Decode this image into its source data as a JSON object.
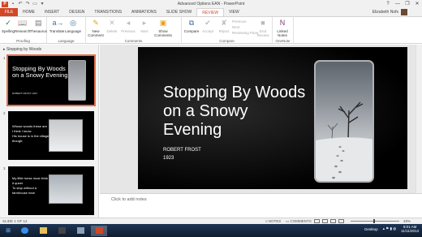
{
  "window": {
    "title": "Advanced Options EAN - PowerPoint",
    "controls": [
      "?",
      "—",
      "❐",
      "✕"
    ]
  },
  "tabs": [
    "FILE",
    "HOME",
    "INSERT",
    "DESIGN",
    "TRANSITIONS",
    "ANIMATIONS",
    "SLIDE SHOW",
    "REVIEW",
    "VIEW"
  ],
  "active_tab": "REVIEW",
  "user": {
    "name": "Elizabeth Nofs"
  },
  "ribbon": {
    "proofing": {
      "label": "Proofing",
      "spelling": "Spelling",
      "research": "Research",
      "thesaurus": "Thesaurus"
    },
    "language": {
      "label": "Language",
      "translate": "Translate",
      "language": "Language"
    },
    "comments": {
      "label": "Comments",
      "new": "New Comment",
      "delete": "Delete",
      "previous": "Previous",
      "next": "Next",
      "show": "Show Comments"
    },
    "compare": {
      "label": "Compare",
      "compare": "Compare",
      "accept": "Accept",
      "reject": "Reject",
      "previous": "Previous",
      "next": "Next",
      "reviewing_pane": "Reviewing Pane",
      "end_review": "End Review"
    },
    "onenote": {
      "label": "OneNote",
      "linked_notes": "Linked Notes"
    }
  },
  "slides_pane": {
    "section": "Stopping by Woods",
    "slides": [
      {
        "number": "1",
        "title": "Stopping By Woods on a Snowy Evening",
        "subtitle": "ROBERT FROST 1923"
      },
      {
        "number": "2",
        "lines": [
          "Whose woods these are",
          "I think I know.",
          "His house is in the village",
          "though;"
        ]
      },
      {
        "number": "3",
        "lines": [
          "My little horse must think",
          "it queer",
          "To stop without a",
          "farmhouse near"
        ]
      }
    ]
  },
  "slide": {
    "title": "Stopping By Woods on a Snowy Evening",
    "author": "ROBERT FROST",
    "year": "1923"
  },
  "notes_placeholder": "Click to add notes",
  "status": {
    "slide_info": "SLIDE 1 OF 12",
    "notes": "NOTES",
    "comments": "COMMENTS",
    "zoom": "49%"
  },
  "taskbar": {
    "desktop": "Desktop",
    "time": "9:01 AM",
    "date": "11/11/2013"
  }
}
